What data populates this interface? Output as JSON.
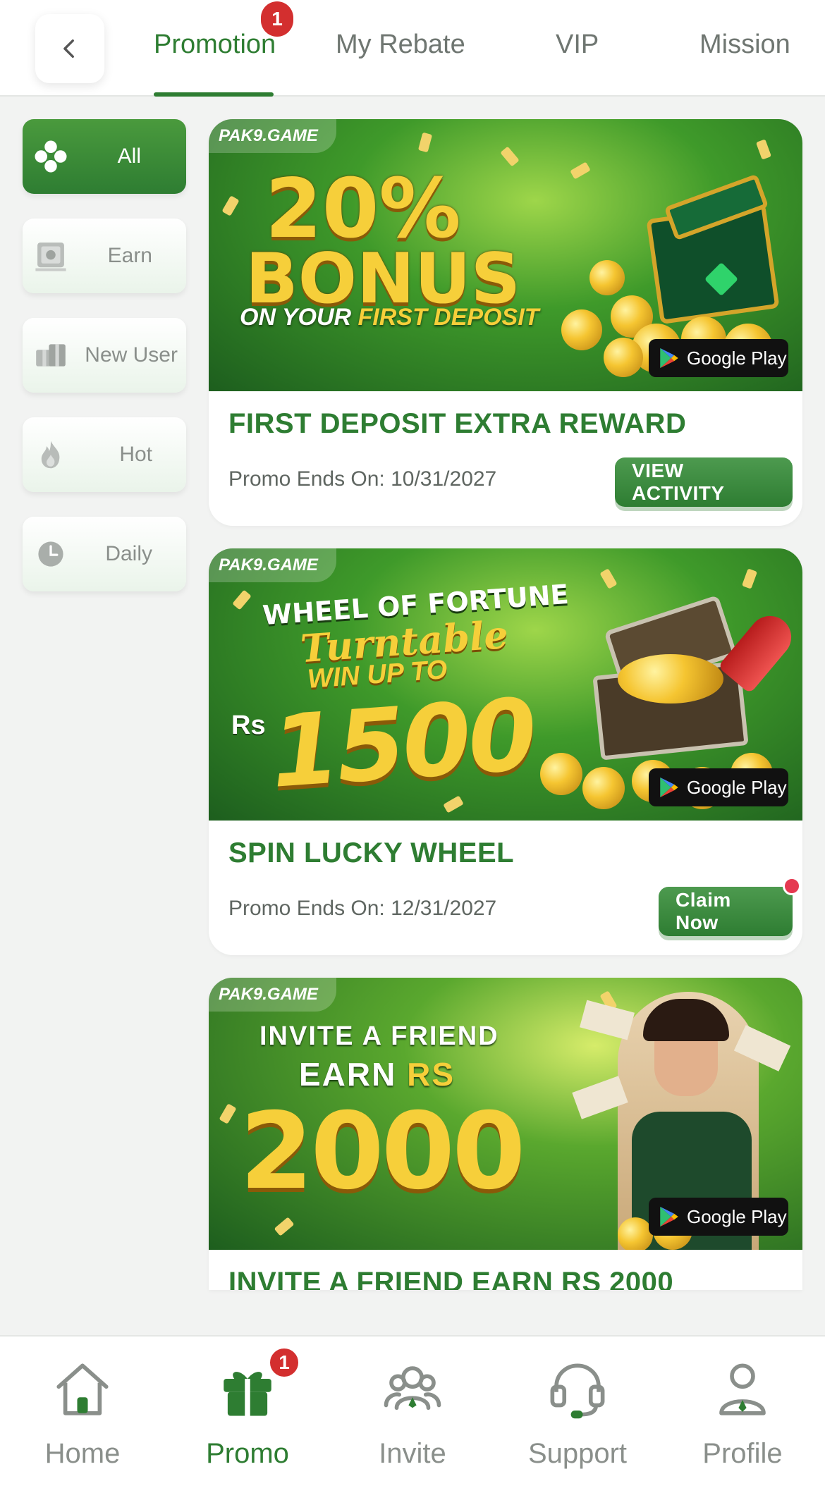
{
  "tabs": [
    {
      "label": "Promotion",
      "active": true,
      "badge": "1"
    },
    {
      "label": "My Rebate"
    },
    {
      "label": "VIP"
    },
    {
      "label": "Mission"
    }
  ],
  "sidebar": {
    "items": [
      {
        "label": "All",
        "icon": "clover-icon",
        "active": true
      },
      {
        "label": "Earn",
        "icon": "safe-icon"
      },
      {
        "label": "New User",
        "icon": "gift-boxes-icon"
      },
      {
        "label": "Hot",
        "icon": "flame-icon"
      },
      {
        "label": "Daily",
        "icon": "clock-icon"
      }
    ]
  },
  "cards": [
    {
      "brand": "PAK9.GAME",
      "banner": {
        "line1": "20%",
        "line2": "BONUS",
        "line3a": "ON YOUR ",
        "line3b": "FIRST DEPOSIT"
      },
      "store_badge": "Google Play",
      "title": "FIRST DEPOSIT EXTRA REWARD",
      "date": "Promo Ends On: 10/31/2027",
      "button": "VIEW ACTIVITY"
    },
    {
      "brand": "PAK9.GAME",
      "banner": {
        "line1": "WHEEL OF FORTUNE",
        "line2": "Turntable",
        "line3": "WIN UP TO",
        "currency": "Rs",
        "amount": "1500"
      },
      "store_badge": "Google Play",
      "title": "SPIN LUCKY WHEEL",
      "date": "Promo Ends On: 12/31/2027",
      "button": "Claim Now"
    },
    {
      "brand": "PAK9.GAME",
      "banner": {
        "line1": "INVITE A FRIEND",
        "line2a": "EARN ",
        "line2b": "RS",
        "amount": "2000"
      },
      "store_badge": "Google Play",
      "title": "INVITE A FRIEND EARN RS 2000"
    }
  ],
  "bottom_nav": [
    {
      "label": "Home",
      "icon": "home-icon"
    },
    {
      "label": "Promo",
      "icon": "gift-icon",
      "active": true,
      "badge": "1"
    },
    {
      "label": "Invite",
      "icon": "people-icon"
    },
    {
      "label": "Support",
      "icon": "headset-icon"
    },
    {
      "label": "Profile",
      "icon": "person-icon"
    }
  ],
  "colors": {
    "accent": "#2e7d32",
    "badge": "#d32f2f",
    "gold": "#f5c531"
  }
}
